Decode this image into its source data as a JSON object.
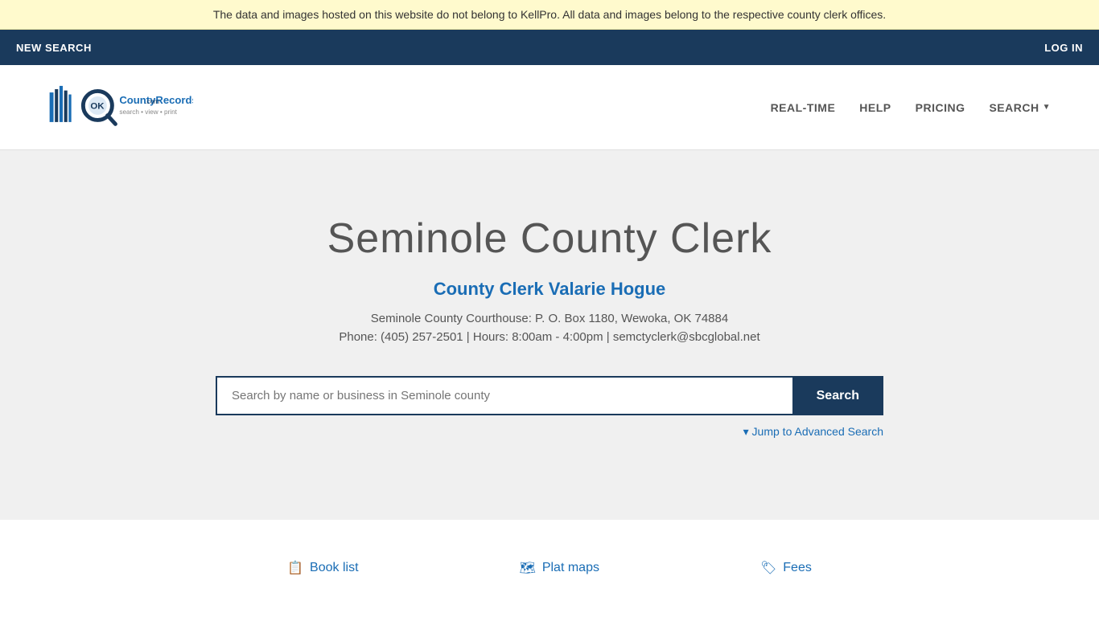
{
  "banner": {
    "text": "The data and images hosted on this website do not belong to KellPro. All data and images belong to the respective county clerk offices."
  },
  "topnav": {
    "new_search": "NEW SEARCH",
    "login": "LOG IN"
  },
  "header": {
    "logo_alt": "OKCountyRecords.com",
    "logo_tagline": "search • view • print",
    "nav": {
      "realtime": "REAL-TIME",
      "help": "HELP",
      "pricing": "PRICING",
      "search": "SEARCH"
    }
  },
  "hero": {
    "title": "Seminole County Clerk",
    "clerk_name": "County Clerk Valarie Hogue",
    "address": "Seminole County Courthouse: P. O. Box 1180, Wewoka, OK 74884",
    "contact": "Phone: (405) 257-2501 | Hours: 8:00am - 4:00pm | semctyclerk@sbcglobal.net",
    "search": {
      "placeholder": "Search by name or business in Seminole county",
      "button_label": "Search",
      "advanced_link": "▾ Jump to Advanced Search"
    }
  },
  "footer": {
    "links": [
      {
        "label": "Book list",
        "icon": "📋"
      },
      {
        "label": "Plat maps",
        "icon": "🗺"
      },
      {
        "label": "Fees",
        "icon": "🏷"
      }
    ]
  }
}
